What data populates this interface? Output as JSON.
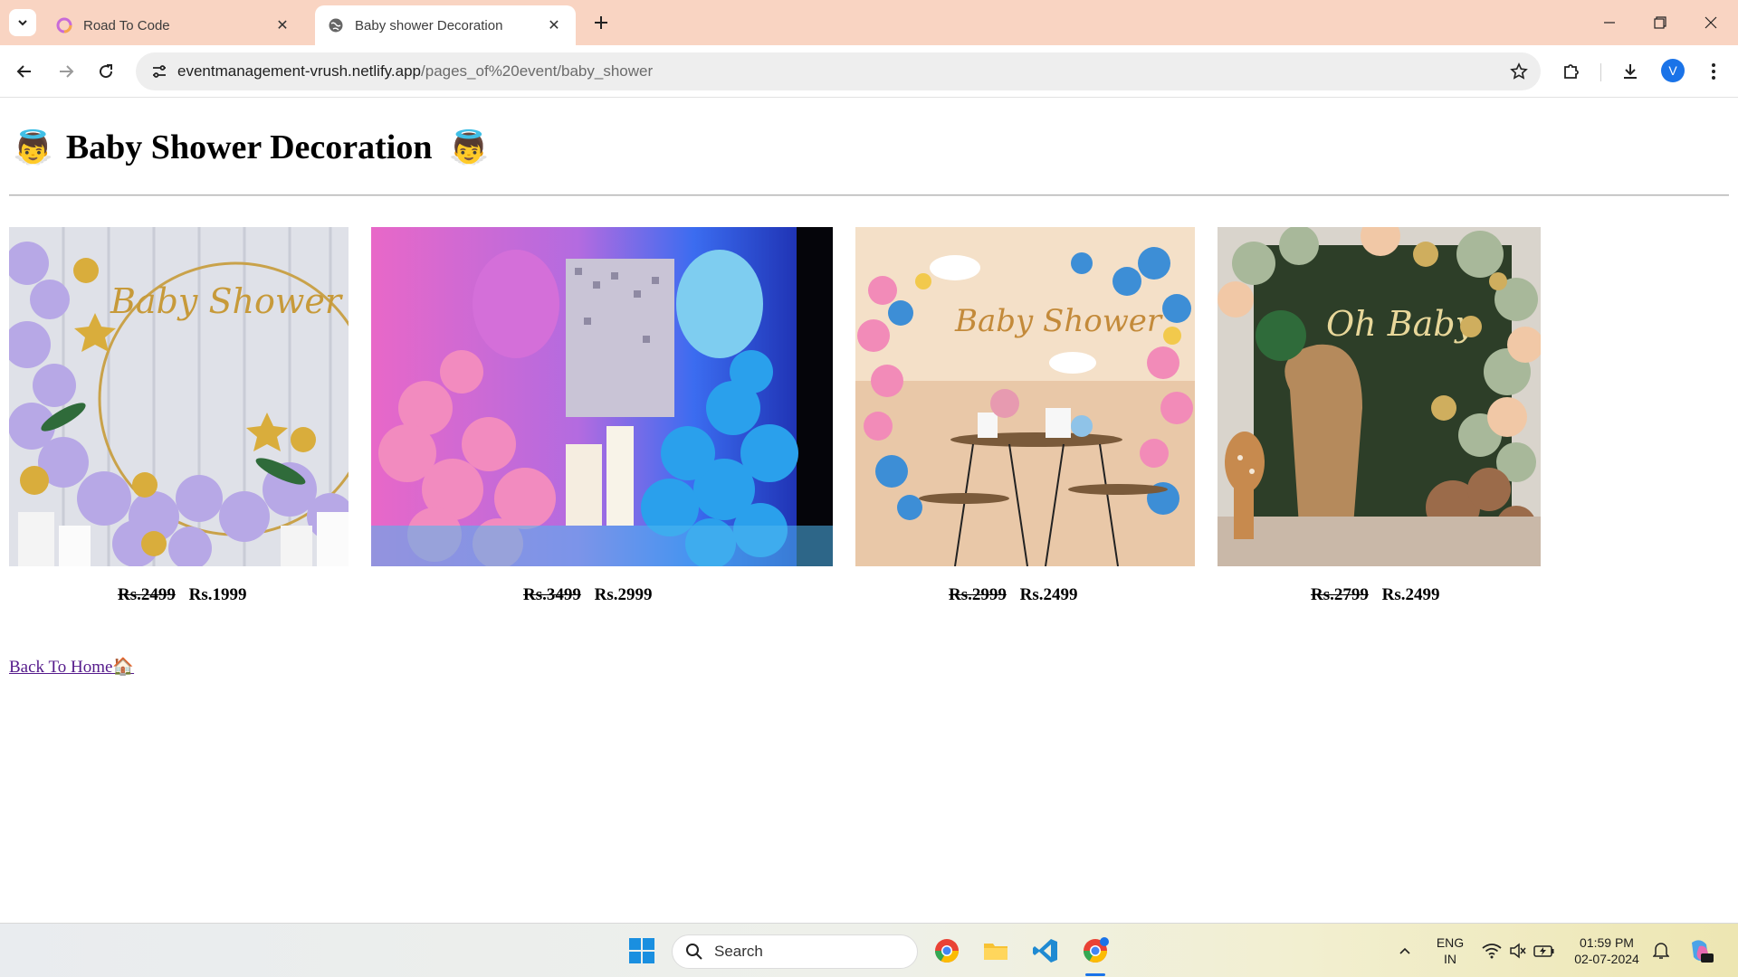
{
  "browser": {
    "tabs": [
      {
        "title": "Road To Code",
        "active": false
      },
      {
        "title": "Baby shower Decoration",
        "active": true
      }
    ],
    "url_host": "eventmanagement-vrush.netlify.app",
    "url_path": "/pages_of%20event/baby_shower",
    "profile_initial": "V"
  },
  "page": {
    "title": "Baby Shower Decoration",
    "title_emoji_left": "👼",
    "title_emoji_right": "👼",
    "products": [
      {
        "image_alt": "Baby Shower lavender gold balloon arch",
        "old_price": "Rs.2499",
        "price": "Rs.1999"
      },
      {
        "image_alt": "Pink and blue hot air balloon decoration",
        "old_price": "Rs.3499",
        "price": "Rs.2999"
      },
      {
        "image_alt": "Baby Shower pink blue balloon table setup",
        "old_price": "Rs.2999",
        "price": "Rs.2499"
      },
      {
        "image_alt": "Oh Baby green gold balloon backdrop",
        "old_price": "Rs.2799",
        "price": "Rs.2499"
      }
    ],
    "back_link": "Back To Home🏠"
  },
  "taskbar": {
    "search_placeholder": "Search",
    "lang_line1": "ENG",
    "lang_line2": "IN",
    "time": "01:59 PM",
    "date": "02-07-2024"
  }
}
